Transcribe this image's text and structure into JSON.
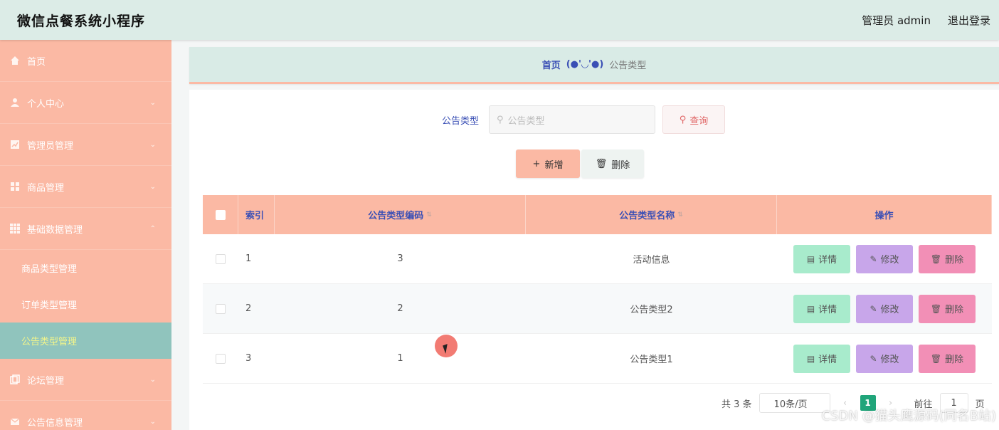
{
  "header": {
    "title": "微信点餐系统小程序",
    "user": "管理员 admin",
    "logout": "退出登录"
  },
  "sidebar": {
    "items": [
      {
        "label": "首页",
        "icon": "home-icon"
      },
      {
        "label": "个人中心",
        "icon": "user-icon"
      },
      {
        "label": "管理员管理",
        "icon": "chart-icon"
      },
      {
        "label": "商品管理",
        "icon": "grid-icon"
      },
      {
        "label": "基础数据管理",
        "icon": "apps-icon"
      },
      {
        "label": "论坛管理",
        "icon": "copy-icon"
      },
      {
        "label": "公告信息管理",
        "icon": "mail-icon"
      }
    ],
    "subitems": [
      {
        "label": "商品类型管理"
      },
      {
        "label": "订单类型管理"
      },
      {
        "label": "公告类型管理"
      }
    ]
  },
  "breadcrumb": {
    "home": "首页",
    "separator": "(●'◡'●)",
    "current": "公告类型"
  },
  "search": {
    "label": "公告类型",
    "placeholder": "公告类型",
    "query_button": "查询"
  },
  "actions": {
    "add": "新增",
    "delete": "删除"
  },
  "table": {
    "headers": {
      "index": "索引",
      "code": "公告类型编码",
      "name": "公告类型名称",
      "ops": "操作"
    },
    "rows": [
      {
        "index": "1",
        "code": "3",
        "name": "活动信息"
      },
      {
        "index": "2",
        "code": "2",
        "name": "公告类型2"
      },
      {
        "index": "3",
        "code": "1",
        "name": "公告类型1"
      }
    ],
    "row_buttons": {
      "detail": "详情",
      "edit": "修改",
      "delete": "删除"
    }
  },
  "pagination": {
    "total": "共 3 条",
    "page_size": "10条/页",
    "current_page": "1",
    "goto_label": "前往",
    "goto_value": "1",
    "page_suffix": "页"
  },
  "watermark": "CSDN @猫头鹰源码(同名B站)",
  "colors": {
    "sidebar": "#fbb9a4",
    "active_sub": "#90c4bd",
    "header": "#dcece7",
    "accent_text": "#3a4fb5"
  }
}
